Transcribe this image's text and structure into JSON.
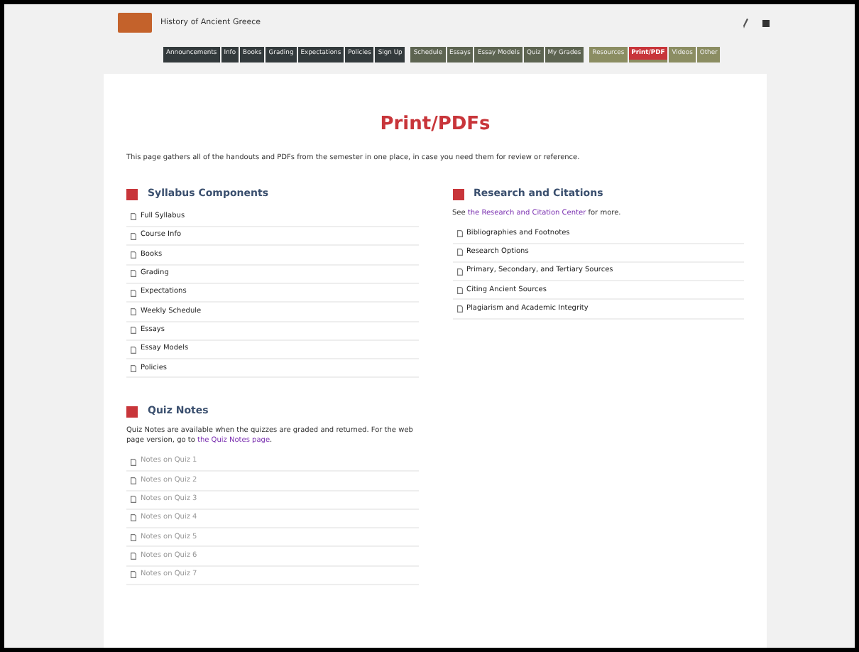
{
  "header": {
    "title": "History of Ancient Greece"
  },
  "nav": [
    {
      "label": "Announcements",
      "color": "#333a3c",
      "selected": false
    },
    {
      "label": "Info",
      "color": "#333a3c",
      "selected": false
    },
    {
      "label": "Books",
      "color": "#333a3c",
      "selected": false
    },
    {
      "label": "Grading",
      "color": "#333a3c",
      "selected": false
    },
    {
      "label": "Expectations",
      "color": "#333a3c",
      "selected": false
    },
    {
      "label": "Policies",
      "color": "#333a3c",
      "selected": false
    },
    {
      "label": "Sign Up",
      "color": "#333a3c",
      "selected": false
    },
    {
      "label": "Schedule",
      "color": "#5d6451",
      "selected": false
    },
    {
      "label": "Essays",
      "color": "#5d6451",
      "selected": false
    },
    {
      "label": "Essay Models",
      "color": "#5d6451",
      "selected": false
    },
    {
      "label": "Quiz",
      "color": "#5d6451",
      "selected": false
    },
    {
      "label": "My Grades",
      "color": "#5d6451",
      "selected": false
    },
    {
      "label": "Resources",
      "color": "#8b8d62",
      "selected": false
    },
    {
      "label": "Print/PDF",
      "color": "#8b8d62",
      "selected": true
    },
    {
      "label": "Videos",
      "color": "#8b8d62",
      "selected": false
    },
    {
      "label": "Other",
      "color": "#8b8d62",
      "selected": false
    }
  ],
  "page": {
    "title": "Print/PDFs",
    "intro": "This page gathers all of the handouts and PDFs from the semester in one place, in case you need them for review or reference."
  },
  "sections": [
    {
      "title": "Syllabus Components",
      "items": [
        {
          "label": "Full Syllabus",
          "disabled": false
        },
        {
          "label": "Course Info",
          "disabled": false
        },
        {
          "label": "Books",
          "disabled": false
        },
        {
          "label": "Grading",
          "disabled": false
        },
        {
          "label": "Expectations",
          "disabled": false
        },
        {
          "label": "Weekly Schedule",
          "disabled": false
        },
        {
          "label": "Essays",
          "disabled": false
        },
        {
          "label": "Essay Models",
          "disabled": false
        },
        {
          "label": "Policies",
          "disabled": false
        }
      ]
    },
    {
      "title": "Research and Citations",
      "note": {
        "before": "See ",
        "link": "the Research and Citation Center",
        "after": " for more."
      },
      "items": [
        {
          "label": "Bibliographies and Footnotes",
          "disabled": false
        },
        {
          "label": "Research Options",
          "disabled": false
        },
        {
          "label": "Primary, Secondary, and Tertiary Sources",
          "disabled": false
        },
        {
          "label": "Citing Ancient Sources",
          "disabled": false
        },
        {
          "label": "Plagiarism and Academic Integrity",
          "disabled": false
        }
      ]
    },
    {
      "title": "Quiz Notes",
      "note": {
        "before": "Quiz Notes are available when the quizzes are graded and returned. For the web page version, go to ",
        "link": "the Quiz Notes page",
        "after": "."
      },
      "items": [
        {
          "label": "Notes on Quiz 1",
          "disabled": true
        },
        {
          "label": "Notes on Quiz 2",
          "disabled": true
        },
        {
          "label": "Notes on Quiz 3",
          "disabled": true
        },
        {
          "label": "Notes on Quiz 4",
          "disabled": true
        },
        {
          "label": "Notes on Quiz 5",
          "disabled": true
        },
        {
          "label": "Notes on Quiz 6",
          "disabled": true
        },
        {
          "label": "Notes on Quiz 7",
          "disabled": true
        }
      ]
    }
  ]
}
